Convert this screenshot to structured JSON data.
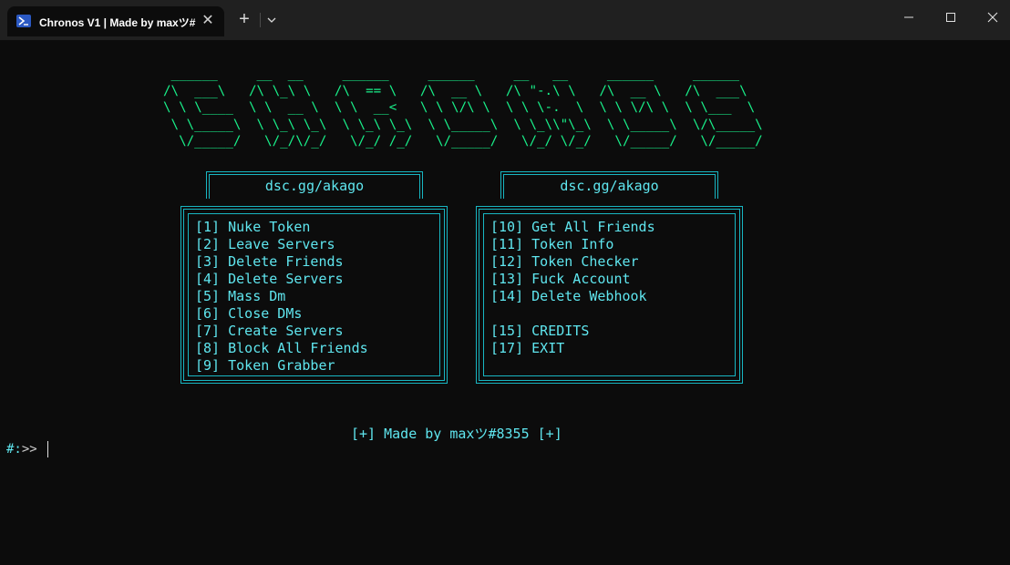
{
  "window": {
    "tab_title": "Chronos V1 | Made by maxツ#",
    "new_tab_label": "+",
    "close_tab_label": "✕"
  },
  "banner": {
    "ascii_art": " ______     __  __     ______     ______     __   __     ______     ______\n/\\  ___\\   /\\ \\_\\ \\   /\\  == \\   /\\  __ \\   /\\ \"-.\\ \\   /\\  __ \\   /\\  ___\\\n\\ \\ \\____  \\ \\  __ \\  \\ \\  __<   \\ \\ \\/\\ \\  \\ \\ \\-.  \\  \\ \\ \\/\\ \\  \\ \\___  \\\n \\ \\_____\\  \\ \\_\\ \\_\\  \\ \\_\\ \\_\\  \\ \\_____\\  \\ \\_\\\\\"\\_\\  \\ \\_____\\  \\/\\_____\\\n  \\/_____/   \\/_/\\/_/   \\/_/ /_/   \\/_____/   \\/_/ \\/_/   \\/_____/   \\/_____/"
  },
  "left_panel": {
    "header": "dsc.gg/akago",
    "items": [
      "[1] Nuke Token",
      "[2] Leave Servers",
      "[3] Delete Friends",
      "[4] Delete Servers",
      "[5] Mass Dm",
      "[6] Close DMs",
      "[7] Create Servers",
      "[8] Block All Friends",
      "[9] Token Grabber"
    ]
  },
  "right_panel": {
    "header": "dsc.gg/akago",
    "items": [
      "[10] Get All Friends",
      "[11] Token Info",
      "[12] Token Checker",
      "[13] Fuck Account",
      "[14] Delete Webhook",
      "",
      "[15] CREDITS",
      "[17] EXIT"
    ]
  },
  "footer": {
    "credit": "[+] Made by maxツ#8355 [+]",
    "prompt_symbol": "#:",
    "prompt_arrow": ">>"
  },
  "colors": {
    "background": "#0c0c0c",
    "banner": "#19f08a",
    "border": "#18b6c2",
    "text": "#5fe6ef"
  }
}
